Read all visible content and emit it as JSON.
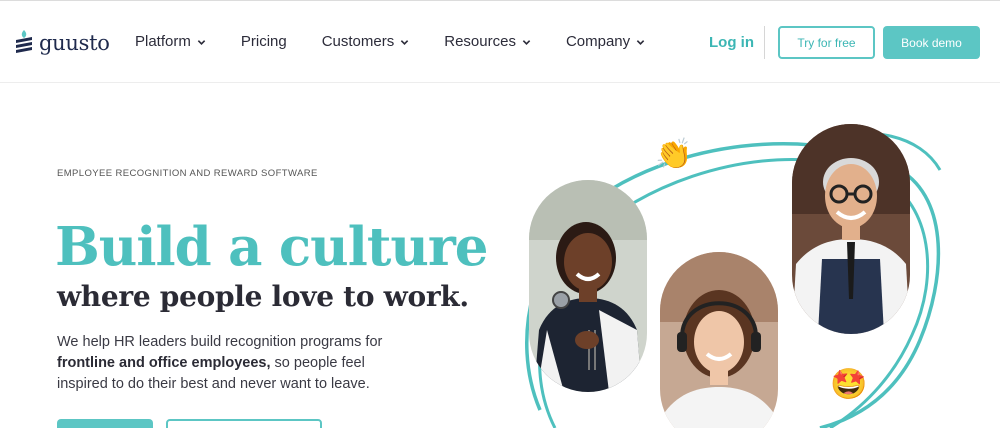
{
  "brand": {
    "name": "guusto",
    "color": "#1f2a4d",
    "accent": "#5cc6c4"
  },
  "nav": {
    "items": [
      {
        "label": "Platform",
        "has_dropdown": true
      },
      {
        "label": "Pricing",
        "has_dropdown": false
      },
      {
        "label": "Customers",
        "has_dropdown": true
      },
      {
        "label": "Resources",
        "has_dropdown": true
      },
      {
        "label": "Company",
        "has_dropdown": true
      }
    ],
    "login_label": "Log in",
    "try_label": "Try for free",
    "demo_label": "Book demo"
  },
  "hero": {
    "eyebrow": "EMPLOYEE RECOGNITION AND REWARD SOFTWARE",
    "headline": "Build a culture",
    "subhead": "where people love to work.",
    "desc_pre": "We help HR leaders build recognition programs for ",
    "desc_bold": "frontline and office employees,",
    "desc_post": " so people feel inspired to do their best and never want to leave."
  },
  "art": {
    "emojis": {
      "clap": "👏",
      "star_struck": "🤩"
    }
  }
}
